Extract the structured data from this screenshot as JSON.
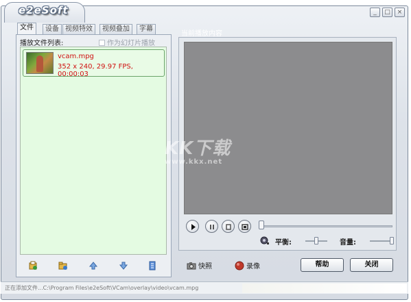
{
  "window": {
    "logo": "e2eSoft",
    "min_label": "_",
    "max_label": "□",
    "close_label": "×"
  },
  "tabs": [
    {
      "label": "文件",
      "active": true
    },
    {
      "label": "设备",
      "active": false
    },
    {
      "label": "视频特效",
      "active": false
    },
    {
      "label": "视频叠加",
      "active": false
    },
    {
      "label": "字幕",
      "active": false
    }
  ],
  "playlist": {
    "label": "播放文件列表:",
    "slideshow_label": "作为幻灯片播放",
    "slideshow_checked": false,
    "items": [
      {
        "name": "vcam.mpg",
        "info": "352 x 240, 29.97 FPS, 00:00:03"
      }
    ]
  },
  "list_toolbar": {
    "icons": [
      "add-file-icon",
      "add-folder-icon",
      "move-up-icon",
      "move-down-icon",
      "properties-icon"
    ]
  },
  "preview": {
    "title": "当前播放内容",
    "watermark_main": "KK下载",
    "watermark_url": "www.kkx.net"
  },
  "playback": {
    "controls": [
      "play-icon",
      "pause-icon",
      "stop-icon",
      "loop-icon"
    ],
    "seek_position": 0,
    "balance_label": "平衡:",
    "volume_label": "音量:",
    "balance_level": 0.5,
    "volume_level": 1.0
  },
  "actions": {
    "snapshot_label": "快照",
    "record_label": "录像",
    "help_label": "帮助",
    "close_label": "关闭"
  },
  "status": {
    "text": "正在添加文件...C:\\Program Files\\e2eSoft\\VCam\\overlay\\video\\vcam.mpg"
  },
  "colors": {
    "file_text": "#d01010",
    "list_background": "#e4fbe2",
    "video_background": "#8c8c8e"
  }
}
